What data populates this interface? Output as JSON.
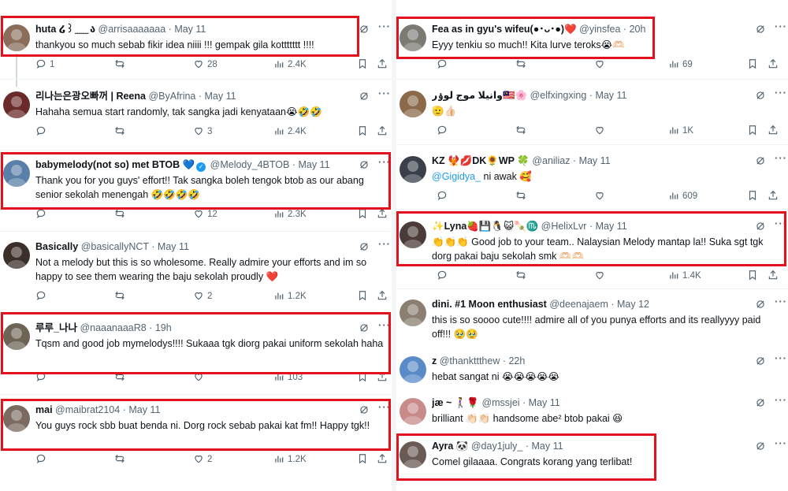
{
  "tweets_left": [
    {
      "name": "huta ໒꒱ ̫ ̫ ̫ ̫ ̫ ა",
      "handle": "@arrisaaaaaaa",
      "date": "May 11",
      "text": "thankyou so much sebab fikir idea niiii !!! gempak gila kottttttt !!!!",
      "replies": "1",
      "reposts": "",
      "likes": "28",
      "views": "2.4K",
      "avatar_color": "#8a6d5b"
    },
    {
      "name": "리나는은광오빠꺼 | Reena",
      "handle": "@ByAfrina",
      "date": "May 11",
      "text": "Hahaha semua start randomly, tak sangka jadi kenyataan😭🤣🤣",
      "replies": "",
      "reposts": "",
      "likes": "3",
      "views": "2.4K",
      "avatar_color": "#6b2a2a"
    },
    {
      "name": "babymelody(not so) met BTOB 💙",
      "handle": "@Melody_4BTOB",
      "date": "May 11",
      "text": "Thank you for you guys' effort!! Tak sangka boleh tengok btob as our abang senior sekolah menengah 🤣🤣🤣🤣",
      "replies": "",
      "reposts": "",
      "likes": "12",
      "views": "2.3K",
      "avatar_color": "#5a7fa8"
    },
    {
      "name": "Basically",
      "handle": "@basicallyNCT",
      "date": "May 11",
      "text": "Not a melody but this is so wholesome. Really admire your efforts and im so happy to see them wearing the baju sekolah proudly ❤️",
      "replies": "",
      "reposts": "",
      "likes": "2",
      "views": "1.2K",
      "avatar_color": "#3b2f2a"
    },
    {
      "name": "루루_나나",
      "handle": "@naaanaaaR8",
      "date": "19h",
      "text": "Tqsm and good job mymelodys!!!! Sukaaa tgk diorg pakai uniform sekolah haha",
      "replies": "",
      "reposts": "",
      "likes": "",
      "views": "103",
      "avatar_color": "#6e6456"
    },
    {
      "name": "mai",
      "handle": "@maibrat2104",
      "date": "May 11",
      "text": "You guys rock sbb buat benda ni. Dorg rock sebab pakai kat fm!! Happy tgk!!",
      "replies": "",
      "reposts": "",
      "likes": "2",
      "views": "1.2K",
      "avatar_color": "#7a6a60"
    }
  ],
  "tweets_right": [
    {
      "name": "Fea as in gyu's wifeu(●･ᴗ･●)❤️",
      "handle": "@yinsfea",
      "date": "20h",
      "text": "Eyyy tenkiu so much!! Kita lurve teroks😭🫶🏻",
      "replies": "",
      "reposts": "",
      "likes": "",
      "views": "69",
      "avatar_color": "#7d7a73"
    },
    {
      "name": "وانيلا موج لوۏر🇲🇾🌸",
      "handle": "@elfxingxing",
      "date": "May 11",
      "text": "🫡👍🏻",
      "replies": "",
      "reposts": "",
      "likes": "",
      "views": "1K",
      "avatar_color": "#8b6a4a"
    },
    {
      "name": "KZ 🐦‍🔥💋DK🌻WP 🍀",
      "handle": "@aniliaz",
      "date": "May 11",
      "mention": "@Gigidya_",
      "text": " ni awak 🥰",
      "replies": "",
      "reposts": "",
      "likes": "",
      "views": "609",
      "avatar_color": "#3a3f4a"
    },
    {
      "name": "✨Lyna🍓💾🐧😺🍡♏️",
      "handle": "@HelixLvr",
      "date": "May 11",
      "text": "👏👏👏 Good job to your team.. Nalaysian Melody mantap la!! Suka sgt tgk dorg pakai baju sekolah smk 🫶🏻🫶🏻",
      "replies": "",
      "reposts": "",
      "likes": "",
      "views": "1.4K",
      "avatar_color": "#4a3b38"
    },
    {
      "name": "dini. #1 Moon enthusiast",
      "handle": "@deenajaem",
      "date": "May 12",
      "text": "this is so soooo cute!!!! admire all of you punya efforts and its reallyyyy paid off!!! 🥹🥹",
      "avatar_color": "#8a7f70"
    },
    {
      "name": "z",
      "handle": "@thankttthew",
      "date": "22h",
      "text": "hebat sangat ni 😭😭😭😭😭",
      "avatar_color": "#5a8ac8"
    },
    {
      "name": "jæ ~ 🚶‍♀️🌹",
      "handle": "@mssjei",
      "date": "May 11",
      "text": "brilliant 👏🏻👏🏻 handsome abe² btob pakai 😆",
      "avatar_color": "#c98a8a"
    },
    {
      "name": "Ayra 🐼",
      "handle": "@day1july_",
      "date": "May 11",
      "text": "Comel gilaaaa. Congrats korang yang terlibat!",
      "avatar_color": "#6a5a55"
    }
  ],
  "icons": {
    "reply": "reply-icon",
    "repost": "repost-icon",
    "like": "heart-icon",
    "views": "views-icon",
    "bookmark": "bookmark-icon",
    "share": "share-icon",
    "grok": "grok-icon",
    "more": "more-icon"
  },
  "colors": {
    "highlight": "#e3111b",
    "link": "#1d9bf0",
    "muted": "#536471"
  }
}
